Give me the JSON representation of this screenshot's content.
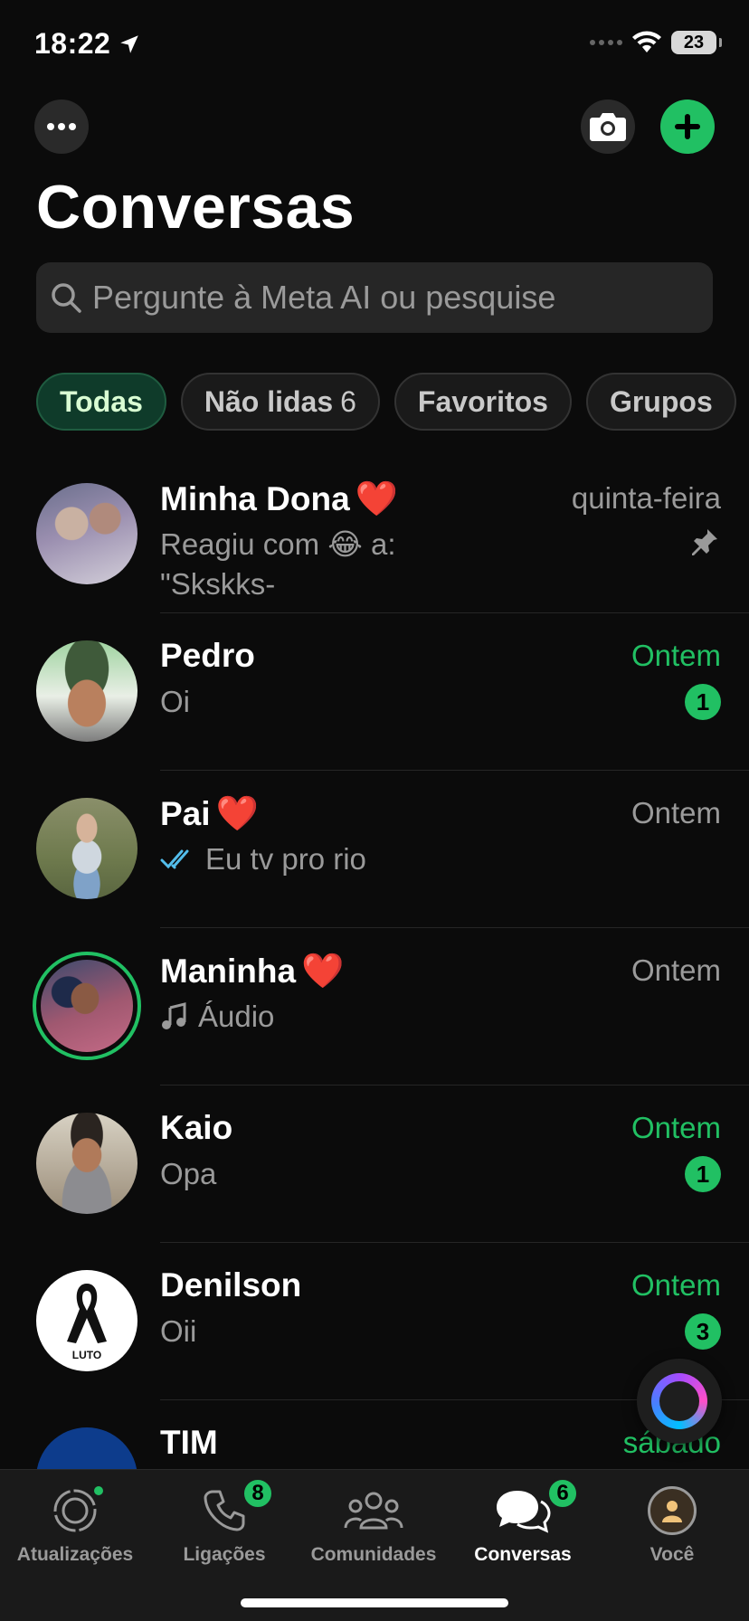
{
  "status_bar": {
    "time": "18:22",
    "battery": "23"
  },
  "header": {
    "title": "Conversas"
  },
  "search": {
    "placeholder": "Pergunte à Meta AI ou pesquise"
  },
  "filters": [
    {
      "label": "Todas",
      "count": ""
    },
    {
      "label": "Não lidas",
      "count": "6"
    },
    {
      "label": "Favoritos",
      "count": ""
    },
    {
      "label": "Grupos",
      "count": ""
    }
  ],
  "chats": [
    {
      "name": "Minha Dona",
      "emoji": "❤️",
      "preview_line1": "Reagiu com 😂 a:",
      "preview_line2": "\"Skskks-",
      "date": "quinta-feira",
      "unread": "",
      "pinned": true
    },
    {
      "name": "Pedro",
      "emoji": "",
      "preview": "Oi",
      "date": "Ontem",
      "unread": "1"
    },
    {
      "name": "Pai",
      "emoji": "❤️",
      "preview": "Eu tv pro rio",
      "date": "Ontem",
      "unread": "",
      "read_receipt": true
    },
    {
      "name": "Maninha",
      "emoji": "❤️",
      "preview": "Áudio",
      "date": "Ontem",
      "unread": "",
      "has_status": true
    },
    {
      "name": "Kaio",
      "emoji": "",
      "preview": "Opa",
      "date": "Ontem",
      "unread": "1"
    },
    {
      "name": "Denilson",
      "emoji": "",
      "preview": "Oii",
      "date": "Ontem",
      "unread": "3",
      "avatar_text": "LUTO"
    },
    {
      "name": "TIM",
      "emoji": "",
      "preview": "",
      "date": "sábado",
      "unread": ""
    }
  ],
  "tabs": [
    {
      "label": "Atualizações",
      "badge": ""
    },
    {
      "label": "Ligações",
      "badge": "8"
    },
    {
      "label": "Comunidades",
      "badge": ""
    },
    {
      "label": "Conversas",
      "badge": "6"
    },
    {
      "label": "Você",
      "badge": ""
    }
  ],
  "colors": {
    "accent": "#21c063",
    "background": "#0b0b0b",
    "muted_text": "#9a9a9a",
    "heart": "#e1251b",
    "read_blue": "#53bdeb"
  },
  "icons": [
    "location-arrow-icon",
    "wifi-icon",
    "more-icon",
    "camera-icon",
    "plus-icon",
    "search-icon",
    "pin-icon",
    "double-check-icon",
    "music-note-icon",
    "meta-ai-icon",
    "updates-icon",
    "phone-icon",
    "communities-icon",
    "chats-icon",
    "profile-icon"
  ]
}
